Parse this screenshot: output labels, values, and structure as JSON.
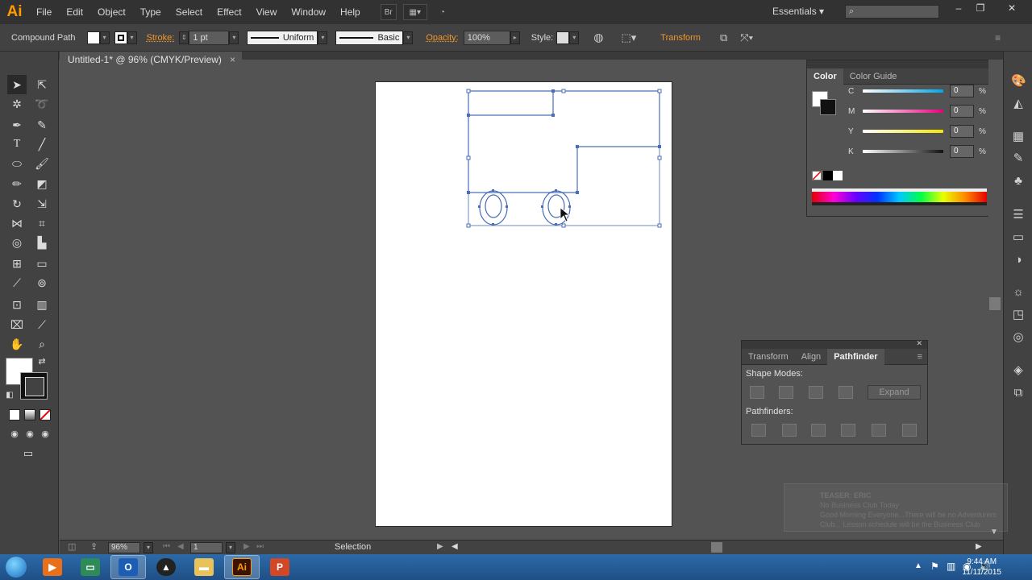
{
  "app": {
    "logo": "Ai",
    "document_tab": "Untitled-1* @ 96% (CMYK/Preview)",
    "close_glyph": "×"
  },
  "menu": [
    "File",
    "Edit",
    "Object",
    "Type",
    "Select",
    "Effect",
    "View",
    "Window",
    "Help"
  ],
  "menubar": {
    "bridge_label": "Br",
    "workspace": "Essentials"
  },
  "control": {
    "selection_type": "Compound Path",
    "stroke_label": "Stroke:",
    "stroke_weight": "1 pt",
    "profile": "Uniform",
    "brush": "Basic",
    "opacity_label": "Opacity:",
    "opacity": "100%",
    "style_label": "Style:",
    "transform_label": "Transform"
  },
  "color_panel": {
    "tabs": [
      "Color",
      "Color Guide"
    ],
    "active_tab": "Color",
    "channels": [
      {
        "letter": "C",
        "value": "0",
        "unit": "%",
        "color": "#00a8e8"
      },
      {
        "letter": "M",
        "value": "0",
        "unit": "%",
        "color": "#e6007e"
      },
      {
        "letter": "Y",
        "value": "0",
        "unit": "%",
        "color": "#f5e600"
      },
      {
        "letter": "K",
        "value": "0",
        "unit": "%",
        "color": "#111111"
      }
    ]
  },
  "pathfinder_panel": {
    "tabs": [
      "Transform",
      "Align",
      "Pathfinder"
    ],
    "active_tab": "Pathfinder",
    "shape_modes_label": "Shape Modes:",
    "pathfinders_label": "Pathfinders:",
    "expand_label": "Expand"
  },
  "status": {
    "zoom": "96%",
    "artboard_number": "1",
    "current_tool": "Selection"
  },
  "notification": {
    "title": "TEASER: ERIC",
    "line1": "No Business Club Today",
    "line2": "Good Morning Everyone...There will be no Adventurers",
    "line3": "Club... Lesson schedule will be the Business Club"
  },
  "taskbar": {
    "time": "9:44 AM",
    "date": "11/11/2015"
  },
  "colors": {
    "accent": "#ff9a00",
    "path": "#4a6db8",
    "canvas": "#535353"
  }
}
